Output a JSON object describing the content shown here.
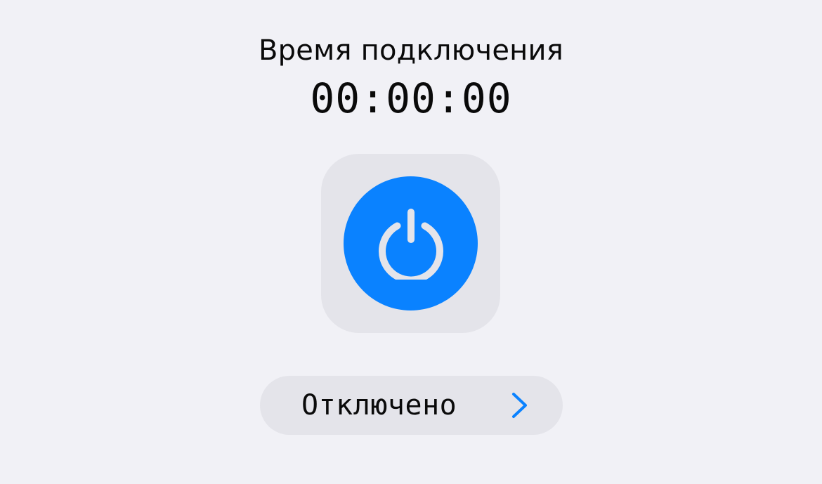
{
  "connection": {
    "title": "Время подключения",
    "timer": "00:00:00"
  },
  "power": {
    "icon": "power-icon",
    "button_color": "#0A82FF",
    "glyph_color": "#E4E4EA",
    "tile_color": "#E4E4EA"
  },
  "status": {
    "label": "Отключено",
    "chevron_icon": "chevron-right-icon",
    "chevron_color": "#0A82FF"
  }
}
